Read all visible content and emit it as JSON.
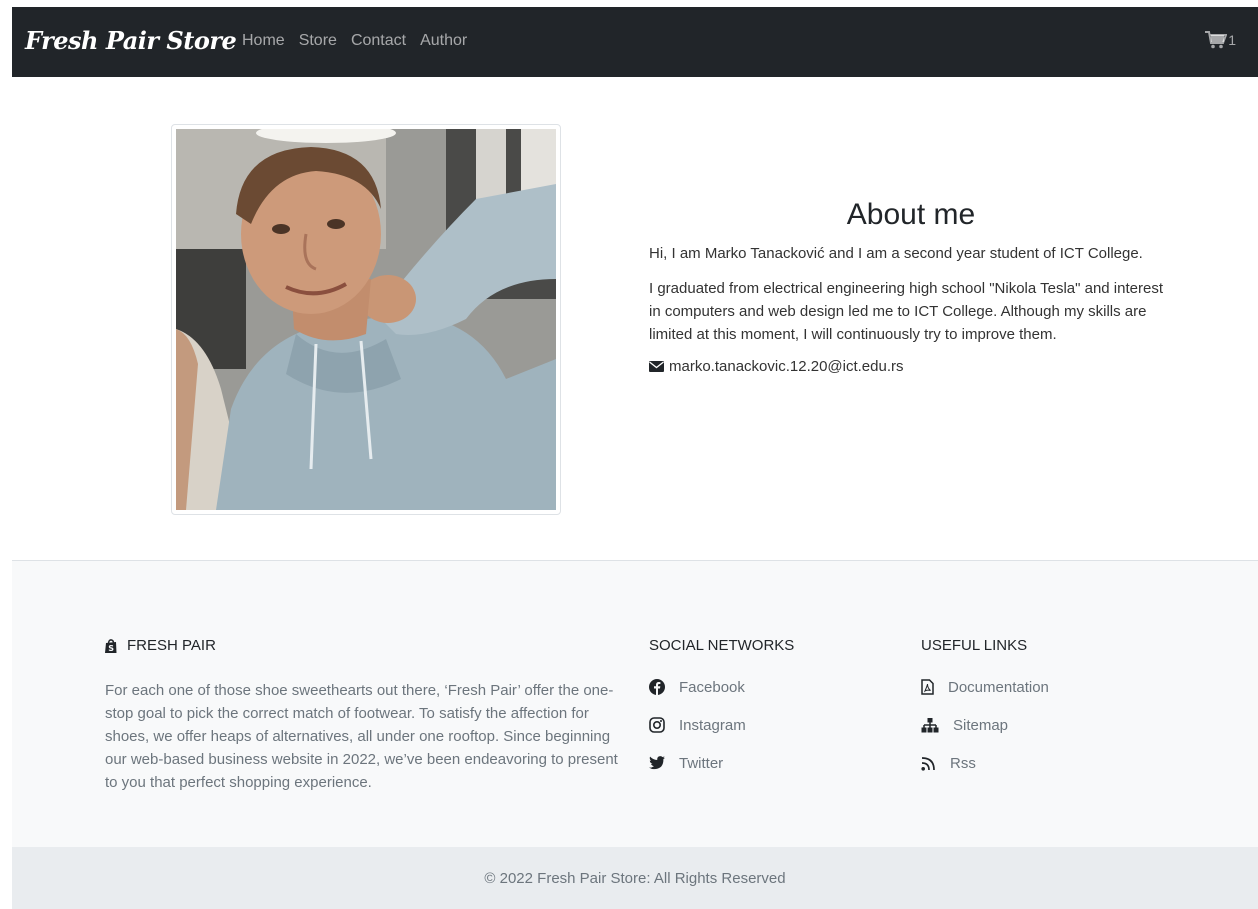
{
  "navbar": {
    "brand": "Fresh Pair Store",
    "links": [
      {
        "label": "Home"
      },
      {
        "label": "Store"
      },
      {
        "label": "Contact"
      },
      {
        "label": "Author"
      }
    ],
    "cart_icon": "shopping-cart-icon",
    "cart_count": "1"
  },
  "about": {
    "title": "About me",
    "paragraph1": "Hi, I am Marko Tanacković and I am a second year student of ICT College.",
    "paragraph2": "I graduated from electrical engineering high school \"Nikola Tesla\" and interest in computers and web design led me to ICT College. Although my skills are limited at this moment, I will continuously try to improve them.",
    "email": "marko.tanackovic.12.20@ict.edu.rs",
    "email_icon": "envelope-icon",
    "photo_icon": "author-portrait"
  },
  "footer": {
    "brand": {
      "title": "FRESH PAIR",
      "icon": "shopify-bag-icon",
      "text": "For each one of those shoe sweethearts out there, ‘Fresh Pair’ offer the one-stop goal to pick the correct match of footwear. To satisfy the affection for shoes, we offer heaps of alternatives, all under one rooftop. Since beginning our web-based business website in 2022, we’ve been endeavoring to present to you that perfect shopping experience."
    },
    "social": {
      "title": "SOCIAL NETWORKS",
      "items": [
        {
          "label": "Facebook",
          "icon": "facebook-icon"
        },
        {
          "label": "Instagram",
          "icon": "instagram-icon"
        },
        {
          "label": "Twitter",
          "icon": "twitter-icon"
        }
      ]
    },
    "useful": {
      "title": "USEFUL LINKS",
      "items": [
        {
          "label": "Documentation",
          "icon": "pdf-file-icon"
        },
        {
          "label": "Sitemap",
          "icon": "sitemap-icon"
        },
        {
          "label": "Rss",
          "icon": "rss-icon"
        }
      ]
    },
    "copyright": "© 2022 Fresh Pair Store: All Rights Reserved"
  },
  "colors": {
    "navbar_bg": "#212529",
    "footer_bg": "#f8f9fa",
    "copyright_bg": "#e9ecef",
    "muted_text": "#6c757d"
  }
}
